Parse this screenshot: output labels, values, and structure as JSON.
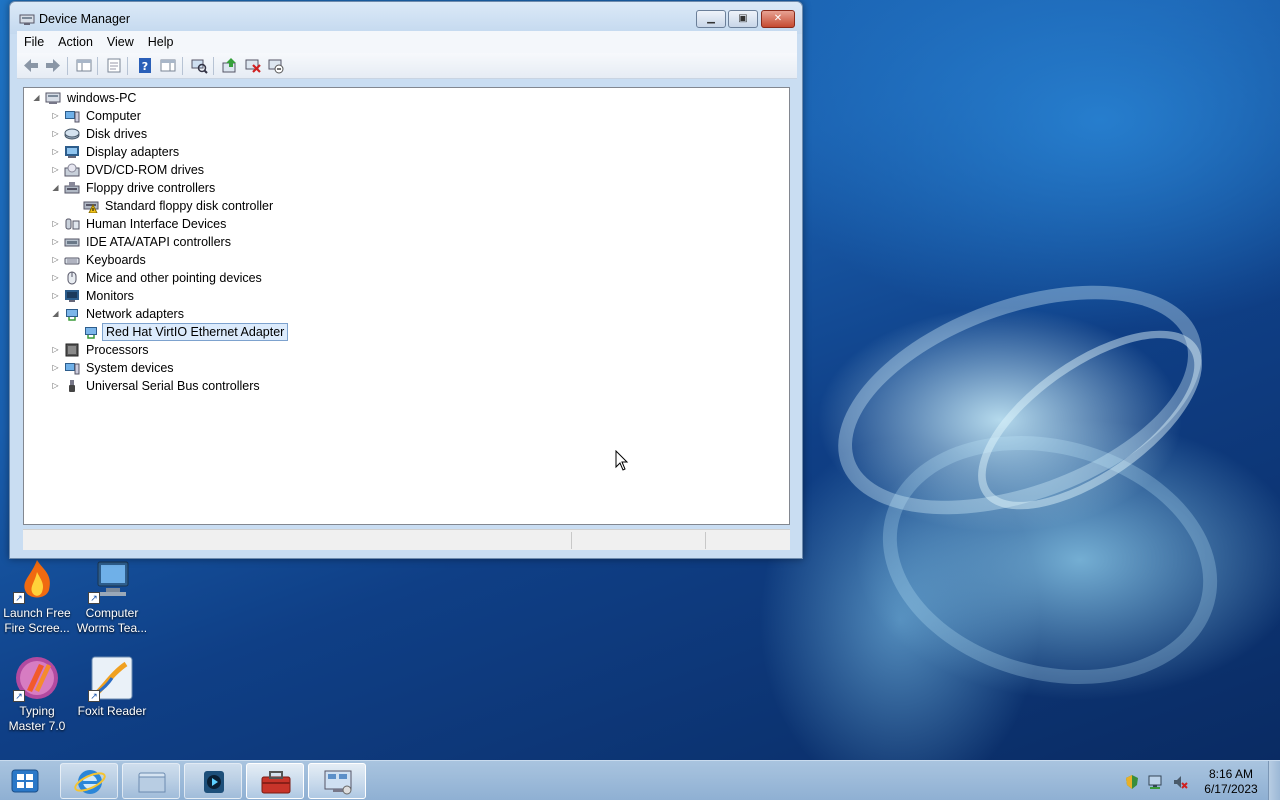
{
  "window": {
    "title": "Device Manager",
    "menu": [
      "File",
      "Action",
      "View",
      "Help"
    ],
    "toolbar_icons": [
      "back-arrow-icon",
      "forward-arrow-icon",
      "show-hide-console-tree-icon",
      "properties-icon",
      "help-icon",
      "action-pane-icon",
      "scan-hardware-icon",
      "update-driver-icon",
      "uninstall-icon",
      "disable-device-icon"
    ]
  },
  "tree": {
    "root": "windows-PC",
    "items": [
      {
        "label": "Computer",
        "icon": "computer-icon",
        "expanded": false,
        "level": 1
      },
      {
        "label": "Disk drives",
        "icon": "disk-drive-icon",
        "expanded": false,
        "level": 1
      },
      {
        "label": "Display adapters",
        "icon": "display-adapter-icon",
        "expanded": false,
        "level": 1
      },
      {
        "label": "DVD/CD-ROM drives",
        "icon": "dvd-drive-icon",
        "expanded": false,
        "level": 1
      },
      {
        "label": "Floppy drive controllers",
        "icon": "floppy-controller-icon",
        "expanded": true,
        "level": 1
      },
      {
        "label": "Standard floppy disk controller",
        "icon": "floppy-controller-warning-icon",
        "level": 2
      },
      {
        "label": "Human Interface Devices",
        "icon": "hid-icon",
        "expanded": false,
        "level": 1
      },
      {
        "label": "IDE ATA/ATAPI controllers",
        "icon": "ide-controller-icon",
        "expanded": false,
        "level": 1
      },
      {
        "label": "Keyboards",
        "icon": "keyboard-icon",
        "expanded": false,
        "level": 1
      },
      {
        "label": "Mice and other pointing devices",
        "icon": "mouse-icon",
        "expanded": false,
        "level": 1
      },
      {
        "label": "Monitors",
        "icon": "monitor-icon",
        "expanded": false,
        "level": 1
      },
      {
        "label": "Network adapters",
        "icon": "network-adapter-icon",
        "expanded": true,
        "level": 1
      },
      {
        "label": "Red Hat VirtIO Ethernet Adapter",
        "icon": "ethernet-adapter-icon",
        "level": 2,
        "selected": true
      },
      {
        "label": "Processors",
        "icon": "processor-icon",
        "expanded": false,
        "level": 1
      },
      {
        "label": "System devices",
        "icon": "system-devices-icon",
        "expanded": false,
        "level": 1
      },
      {
        "label": "Universal Serial Bus controllers",
        "icon": "usb-icon",
        "expanded": false,
        "level": 1
      }
    ]
  },
  "desktop": {
    "icons": [
      {
        "label1": "Launch Free",
        "label2": "Fire Scree...",
        "icon": "fire-screensaver-icon"
      },
      {
        "label1": "Computer",
        "label2": "Worms Tea...",
        "icon": "computer-worms-icon"
      },
      {
        "label1": "Typing",
        "label2": "Master 7.0",
        "icon": "typing-master-icon"
      },
      {
        "label1": "Foxit Reader",
        "label2": "",
        "icon": "foxit-reader-icon"
      }
    ]
  },
  "taskbar": {
    "items": [
      "start-button",
      "internet-explorer-icon",
      "windows-explorer-icon",
      "media-player-icon",
      "toolbox-icon",
      "device-manager-icon"
    ],
    "tray_icons": [
      "security-shield-icon",
      "network-icon",
      "volume-muted-icon"
    ],
    "time": "8:16 AM",
    "date": "6/17/2023"
  },
  "colors": {
    "selection": "#dcebfc",
    "window_frame": "#c9ddf2",
    "taskbar": "#a9c4df"
  }
}
